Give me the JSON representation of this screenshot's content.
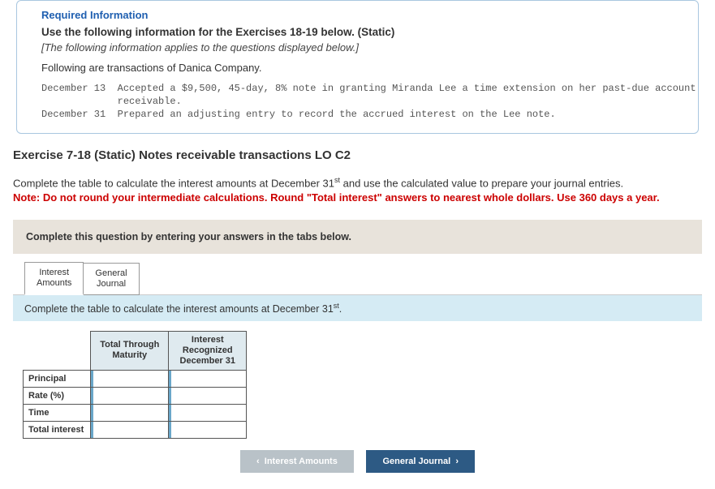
{
  "info": {
    "required_label": "Required Information",
    "use_heading": "Use the following information for the Exercises 18-19 below. (Static)",
    "applies": "[The following information applies to the questions displayed below.]",
    "following": "Following are transactions of Danica Company.",
    "trans_line1": "December 13  Accepted a $9,500, 45-day, 8% note in granting Miranda Lee a time extension on her past-due account",
    "trans_line1b": "             receivable.",
    "trans_line2": "December 31  Prepared an adjusting entry to record the accrued interest on the Lee note."
  },
  "exercise": {
    "title": "Exercise 7-18 (Static) Notes receivable transactions LO C2",
    "instr_pre": "Complete the table to calculate the interest amounts at December 31",
    "instr_sup": "st",
    "instr_post": " and use the calculated value to prepare your journal entries.",
    "note": "Note: Do not round your intermediate calculations. Round \"Total interest\" answers to nearest whole dollars. Use 360 days a year."
  },
  "answers": {
    "bar": "Complete this question by entering your answers in the tabs below.",
    "tab1_l1": "Interest",
    "tab1_l2": "Amounts",
    "tab2_l1": "General",
    "tab2_l2": "Journal",
    "sub_pre": "Complete the table to calculate the interest amounts at December 31",
    "sub_sup": "st",
    "sub_post": "."
  },
  "table": {
    "col1_l1": "Total Through",
    "col1_l2": "Maturity",
    "col2_l1": "Interest",
    "col2_l2": "Recognized",
    "col2_l3": "December 31",
    "rows": {
      "r1": "Principal",
      "r2": "Rate (%)",
      "r3": "Time",
      "r4": "Total interest"
    }
  },
  "nav": {
    "prev": "Interest Amounts",
    "next": "General Journal"
  }
}
